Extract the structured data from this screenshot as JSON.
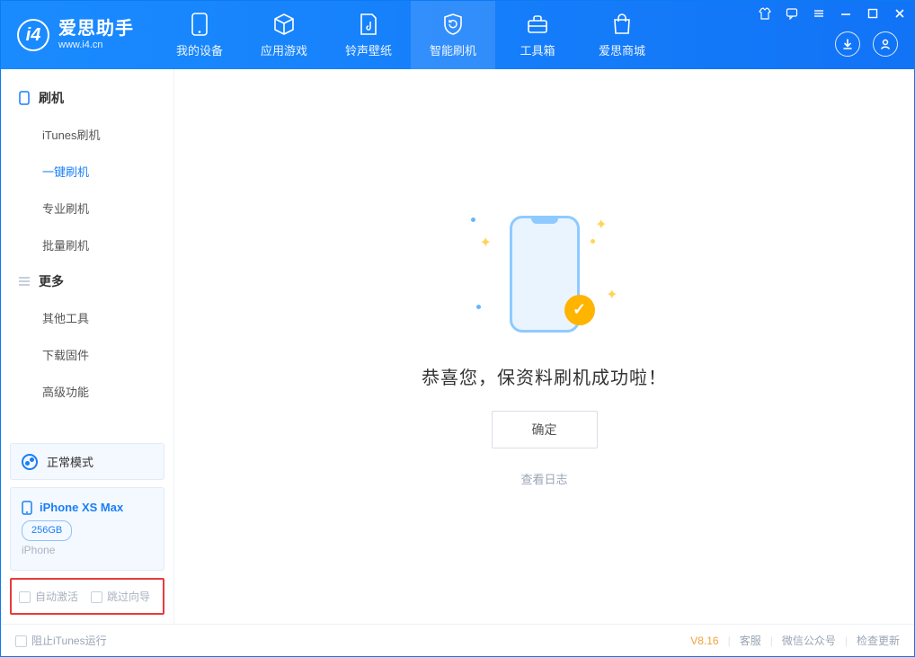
{
  "brand": {
    "cn": "爱思助手",
    "en": "www.i4.cn"
  },
  "topnav": {
    "items": [
      {
        "label": "我的设备"
      },
      {
        "label": "应用游戏"
      },
      {
        "label": "铃声壁纸"
      },
      {
        "label": "智能刷机"
      },
      {
        "label": "工具箱"
      },
      {
        "label": "爱思商城"
      }
    ]
  },
  "sidebar": {
    "section_flash": "刷机",
    "flash_items": [
      {
        "label": "iTunes刷机"
      },
      {
        "label": "一键刷机"
      },
      {
        "label": "专业刷机"
      },
      {
        "label": "批量刷机"
      }
    ],
    "section_more": "更多",
    "more_items": [
      {
        "label": "其他工具"
      },
      {
        "label": "下载固件"
      },
      {
        "label": "高级功能"
      }
    ],
    "mode_label": "正常模式",
    "device": {
      "name": "iPhone XS Max",
      "storage": "256GB",
      "type": "iPhone"
    },
    "opt_auto_activate": "自动激活",
    "opt_skip_guide": "跳过向导"
  },
  "main": {
    "success_message": "恭喜您，保资料刷机成功啦！",
    "ok_button": "确定",
    "view_log": "查看日志"
  },
  "footer": {
    "block_itunes": "阻止iTunes运行",
    "version": "V8.16",
    "links": {
      "support": "客服",
      "wechat": "微信公众号",
      "check_update": "检查更新"
    }
  }
}
